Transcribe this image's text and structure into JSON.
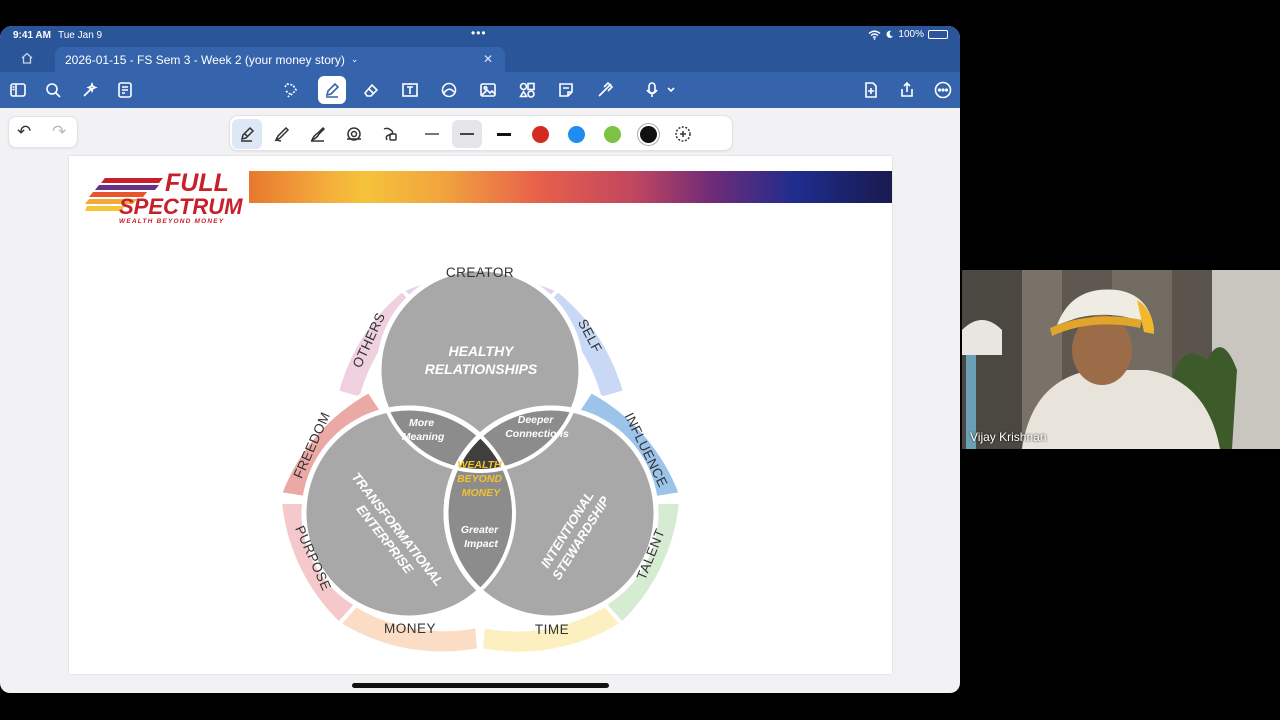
{
  "status_bar": {
    "time": "9:41 AM",
    "date": "Tue Jan 9",
    "battery": "100%"
  },
  "tab": {
    "title": "2026-01-15 - FS Sem 3 - Week 2 (your money story)"
  },
  "colors": {
    "toolbar": "#3564ac",
    "statusbar": "#2a5599",
    "pen_red": "#d52a22",
    "pen_blue": "#1f8cf0",
    "pen_green": "#7dc242",
    "pen_black": "#111111"
  },
  "slide": {
    "logo": {
      "line1": "FULL",
      "line2": "SPECTRUM",
      "tagline": "WEALTH BEYOND MONEY"
    },
    "venn": {
      "circles": {
        "top": "HEALTHY RELATIONSHIPS",
        "left": "TRANSFORMATIONAL ENTERPRISE",
        "right": "INTENTIONAL STEWARDSHIP"
      },
      "overlaps": {
        "top_left_1": "More",
        "top_left_2": "Meaning",
        "top_right_1": "Deeper",
        "top_right_2": "Connections",
        "bottom_1": "Greater",
        "bottom_2": "Impact",
        "center_1": "WEALTH",
        "center_2": "BEYOND",
        "center_3": "MONEY"
      },
      "outer": {
        "creator": "CREATOR",
        "self": "SELF",
        "others": "OTHERS",
        "influence": "INFLUENCE",
        "freedom": "FREEDOM",
        "talent": "TALENT",
        "purpose": "PURPOSE",
        "time": "TIME",
        "money": "MONEY"
      }
    }
  },
  "video": {
    "participant": "Vijay Krishnan"
  }
}
